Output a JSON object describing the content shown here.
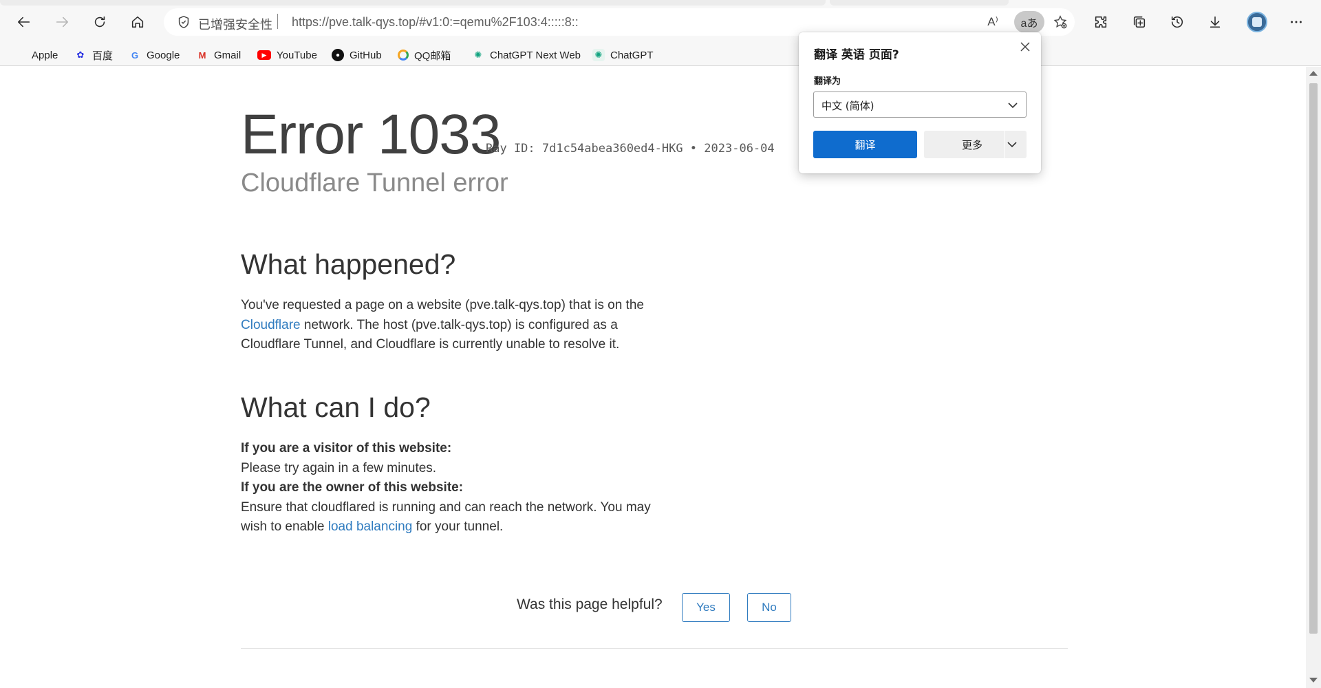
{
  "browser": {
    "address": {
      "security_label": "已增强安全性",
      "url": "https://pve.talk-qys.top/#v1:0:=qemu%2F103:4:::::8::",
      "read_aloud_glyph": "A⁾",
      "translate_glyph": "aあ"
    },
    "bookmarks": [
      {
        "label": "Apple",
        "icon": "apple-icon"
      },
      {
        "label": "百度",
        "icon": "baidu-icon"
      },
      {
        "label": "Google",
        "icon": "google-icon"
      },
      {
        "label": "Gmail",
        "icon": "gmail-icon"
      },
      {
        "label": "YouTube",
        "icon": "youtube-icon"
      },
      {
        "label": "GitHub",
        "icon": "github-icon"
      },
      {
        "label": "QQ邮箱",
        "icon": "qqmail-icon"
      },
      {
        "label": "ChatGPT Next Web",
        "icon": "chatgpt-next-icon"
      },
      {
        "label": "ChatGPT",
        "icon": "chatgpt-icon"
      }
    ]
  },
  "page": {
    "error_title": "Error 1033",
    "ray_id": "Ray ID: 7d1c54abea360ed4-HKG • 2023-06-04",
    "subtitle": "Cloudflare Tunnel error",
    "what_happened": {
      "heading": "What happened?",
      "text_1": "You've requested a page on a website (pve.talk-qys.top) that is on the ",
      "link": "Cloudflare",
      "text_2": " network. The host (pve.talk-qys.top) is configured as a Cloudflare Tunnel, and Cloudflare is currently unable to resolve it."
    },
    "what_can_i_do": {
      "heading": "What can I do?",
      "visitor_label": "If you are a visitor of this website:",
      "visitor_text": "Please try again in a few minutes.",
      "owner_label": "If you are the owner of this website:",
      "owner_text_1": "Ensure that cloudflared is running and can reach the network. You may wish to enable ",
      "owner_link": "load balancing",
      "owner_text_2": " for your tunnel."
    },
    "feedback": {
      "question": "Was this page helpful?",
      "yes": "Yes",
      "no": "No"
    }
  },
  "translate_popup": {
    "title": "翻译 英语 页面?",
    "target_label": "翻译为",
    "target_value": "中文 (简体)",
    "translate_button": "翻译",
    "more_button": "更多"
  },
  "colors": {
    "link": "#2f7bbf",
    "primary_button": "#0f6cce"
  }
}
